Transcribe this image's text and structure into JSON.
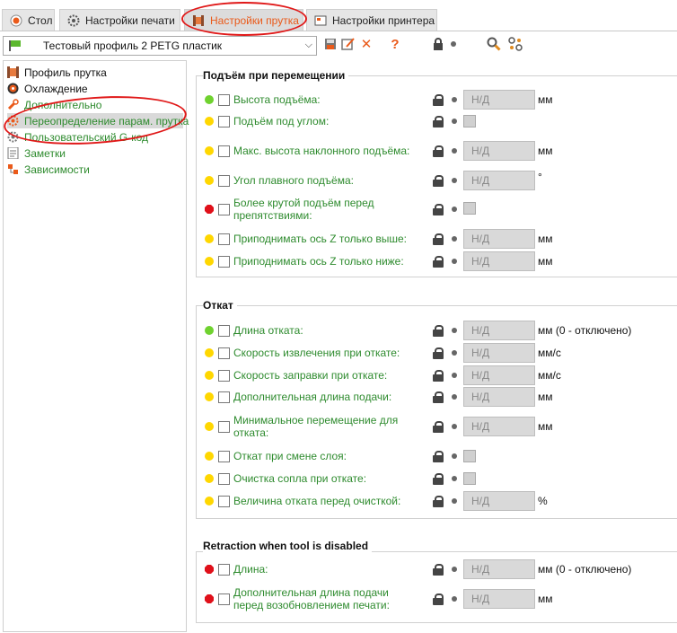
{
  "tabs": [
    {
      "label": "Стол",
      "icon": "bed-icon"
    },
    {
      "label": "Настройки печати",
      "icon": "gear-icon"
    },
    {
      "label": "Настройки прутка",
      "icon": "spool-icon",
      "active": true
    },
    {
      "label": "Настройки принтера",
      "icon": "printer-icon"
    }
  ],
  "preset": {
    "name": "Тестовый профиль 2 PETG пластик"
  },
  "sidebar": {
    "items": [
      {
        "label": "Профиль прутка"
      },
      {
        "label": "Охлаждение"
      },
      {
        "label": "Дополнительно"
      },
      {
        "label": "Переопределение парам. прутка"
      },
      {
        "label": "Пользовательский G-код"
      },
      {
        "label": "Заметки"
      },
      {
        "label": "Зависимости"
      }
    ]
  },
  "sections": {
    "travel_lift": {
      "title": "Подъём при перемещении",
      "rows": [
        {
          "label": "Высота подъёма:",
          "value": "Н/Д",
          "unit": "мм"
        },
        {
          "label": "Подъём под углом:"
        },
        {
          "label": "Макс. высота наклонного подъёма:",
          "value": "Н/Д",
          "unit": "мм"
        },
        {
          "label": "Угол плавного подъёма:",
          "value": "Н/Д",
          "unit": "°"
        },
        {
          "label_line1": "Более крутой подъём перед",
          "label_line2": "препятствиями:"
        },
        {
          "label": "Приподнимать ось Z только выше:",
          "value": "Н/Д",
          "unit": "мм"
        },
        {
          "label": "Приподнимать ось Z только ниже:",
          "value": "Н/Д",
          "unit": "мм"
        }
      ]
    },
    "retraction": {
      "title": "Откат",
      "rows": [
        {
          "label": "Длина отката:",
          "value": "Н/Д",
          "unit": "мм (0 - отключено)"
        },
        {
          "label": "Скорость извлечения при откате:",
          "value": "Н/Д",
          "unit": "мм/с"
        },
        {
          "label": "Скорость заправки при откате:",
          "value": "Н/Д",
          "unit": "мм/с"
        },
        {
          "label": "Дополнительная длина подачи:",
          "value": "Н/Д",
          "unit": "мм"
        },
        {
          "label_line1": "Минимальное перемещение для",
          "label_line2": "отката:",
          "value": "Н/Д",
          "unit": "мм"
        },
        {
          "label": "Откат при смене слоя:"
        },
        {
          "label": "Очистка сопла при откате:"
        },
        {
          "label": "Величина отката перед очисткой:",
          "value": "Н/Д",
          "unit": "%"
        }
      ]
    },
    "tool_disabled": {
      "title": "Retraction when tool is disabled",
      "rows": [
        {
          "label": "Длина:",
          "value": "Н/Д",
          "unit": "мм (0 - отключено)"
        },
        {
          "label_line1": "Дополнительная длина подачи",
          "label_line2": "перед возобновлением печати:",
          "value": "Н/Д",
          "unit": "мм"
        }
      ]
    }
  },
  "colors": {
    "accent": "#ea5a1a",
    "label_green": "#2e8b2e",
    "dot_green": "#6fd22f",
    "dot_yellow": "#ffd700",
    "dot_red": "#e0101a",
    "annotation": "#e01818"
  }
}
